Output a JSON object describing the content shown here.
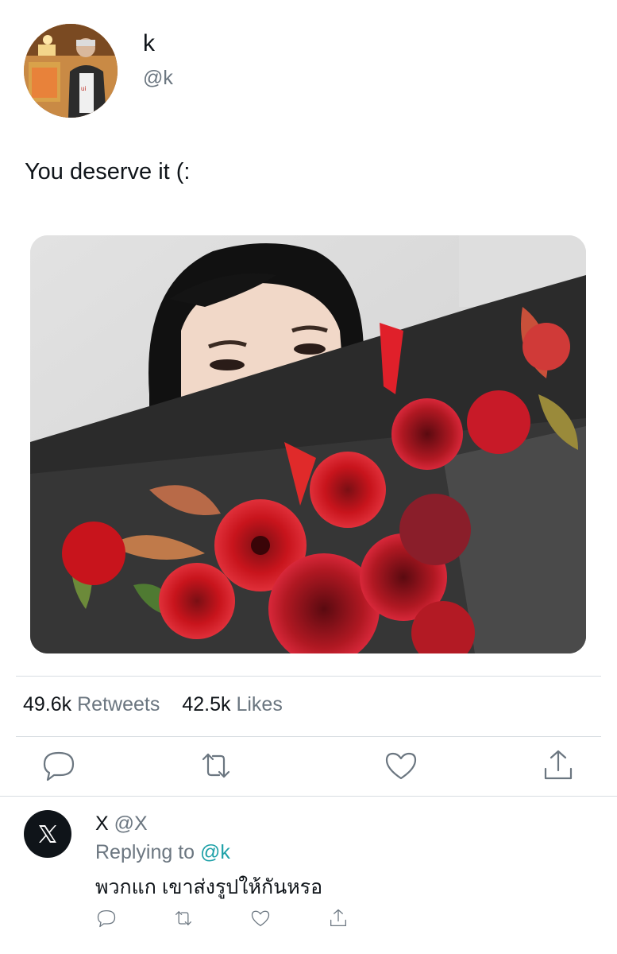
{
  "tweet": {
    "author": {
      "display_name": "k",
      "handle": "@k"
    },
    "text": "You deserve it (:",
    "photo": {
      "description_icon": "photo-image"
    },
    "stats": {
      "retweets_count": "49.6k",
      "retweets_label": "Retweets",
      "likes_count": "42.5k",
      "likes_label": "Likes"
    },
    "actions": [
      "reply-icon",
      "retweet-icon",
      "like-icon",
      "share-icon"
    ]
  },
  "reply": {
    "author": {
      "display_name": "X",
      "handle": "@X"
    },
    "replying_prefix": "Replying to",
    "replying_to": "@k",
    "text": "พวกแก เขาส่งรูปให้กันหรอ",
    "actions": [
      "reply-icon",
      "retweet-icon",
      "like-icon",
      "share-icon"
    ]
  },
  "colors": {
    "text_primary": "#0f1419",
    "text_secondary": "#6b7680",
    "mention": "#1fa1a8",
    "divider": "#d8dde2"
  }
}
